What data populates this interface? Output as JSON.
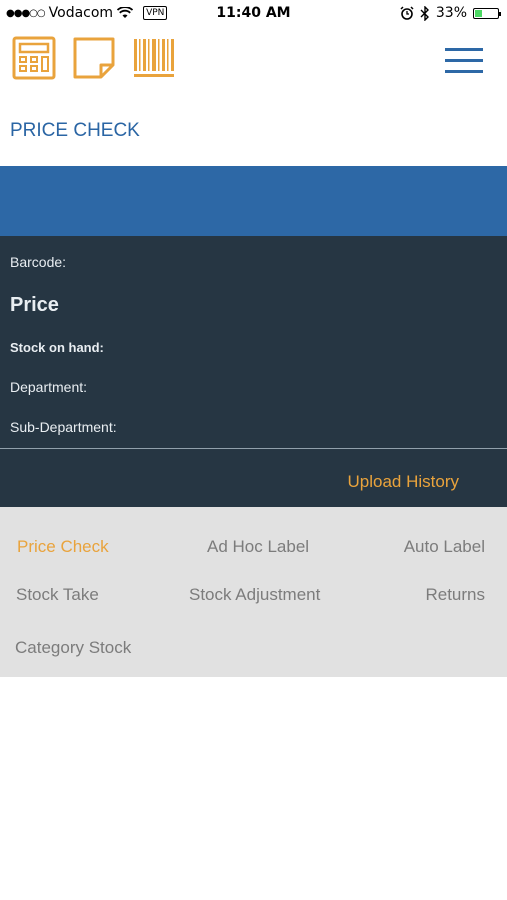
{
  "status": {
    "carrier": "Vodacom",
    "vpn": "VPN",
    "time": "11:40 AM",
    "battery": "33%",
    "battery_level": 0.33
  },
  "toolbar": {
    "icons": [
      "calculator-icon",
      "note-icon",
      "barcode-icon"
    ],
    "accent": "#e9a33c",
    "menu_icon": "hamburger-menu-icon"
  },
  "page": {
    "title": "PRICE CHECK"
  },
  "details": {
    "barcode_label": "Barcode:",
    "price_label": "Price",
    "stock_label": "Stock on hand:",
    "department_label": "Department:",
    "subdepartment_label": "Sub-Department:",
    "upload_history": "Upload History"
  },
  "nav": {
    "items": [
      {
        "label": "Price Check",
        "active": true
      },
      {
        "label": "Ad Hoc Label",
        "active": false
      },
      {
        "label": "Auto Label",
        "active": false
      },
      {
        "label": "Stock Take",
        "active": false
      },
      {
        "label": "Stock Adjustment",
        "active": false
      },
      {
        "label": "Returns",
        "active": false
      },
      {
        "label": "Category Stock",
        "active": false
      }
    ]
  },
  "colors": {
    "primary_blue": "#2d68a6",
    "dark_panel": "#263643",
    "accent_orange": "#e9a33c",
    "nav_bg": "#e1e1e1"
  }
}
